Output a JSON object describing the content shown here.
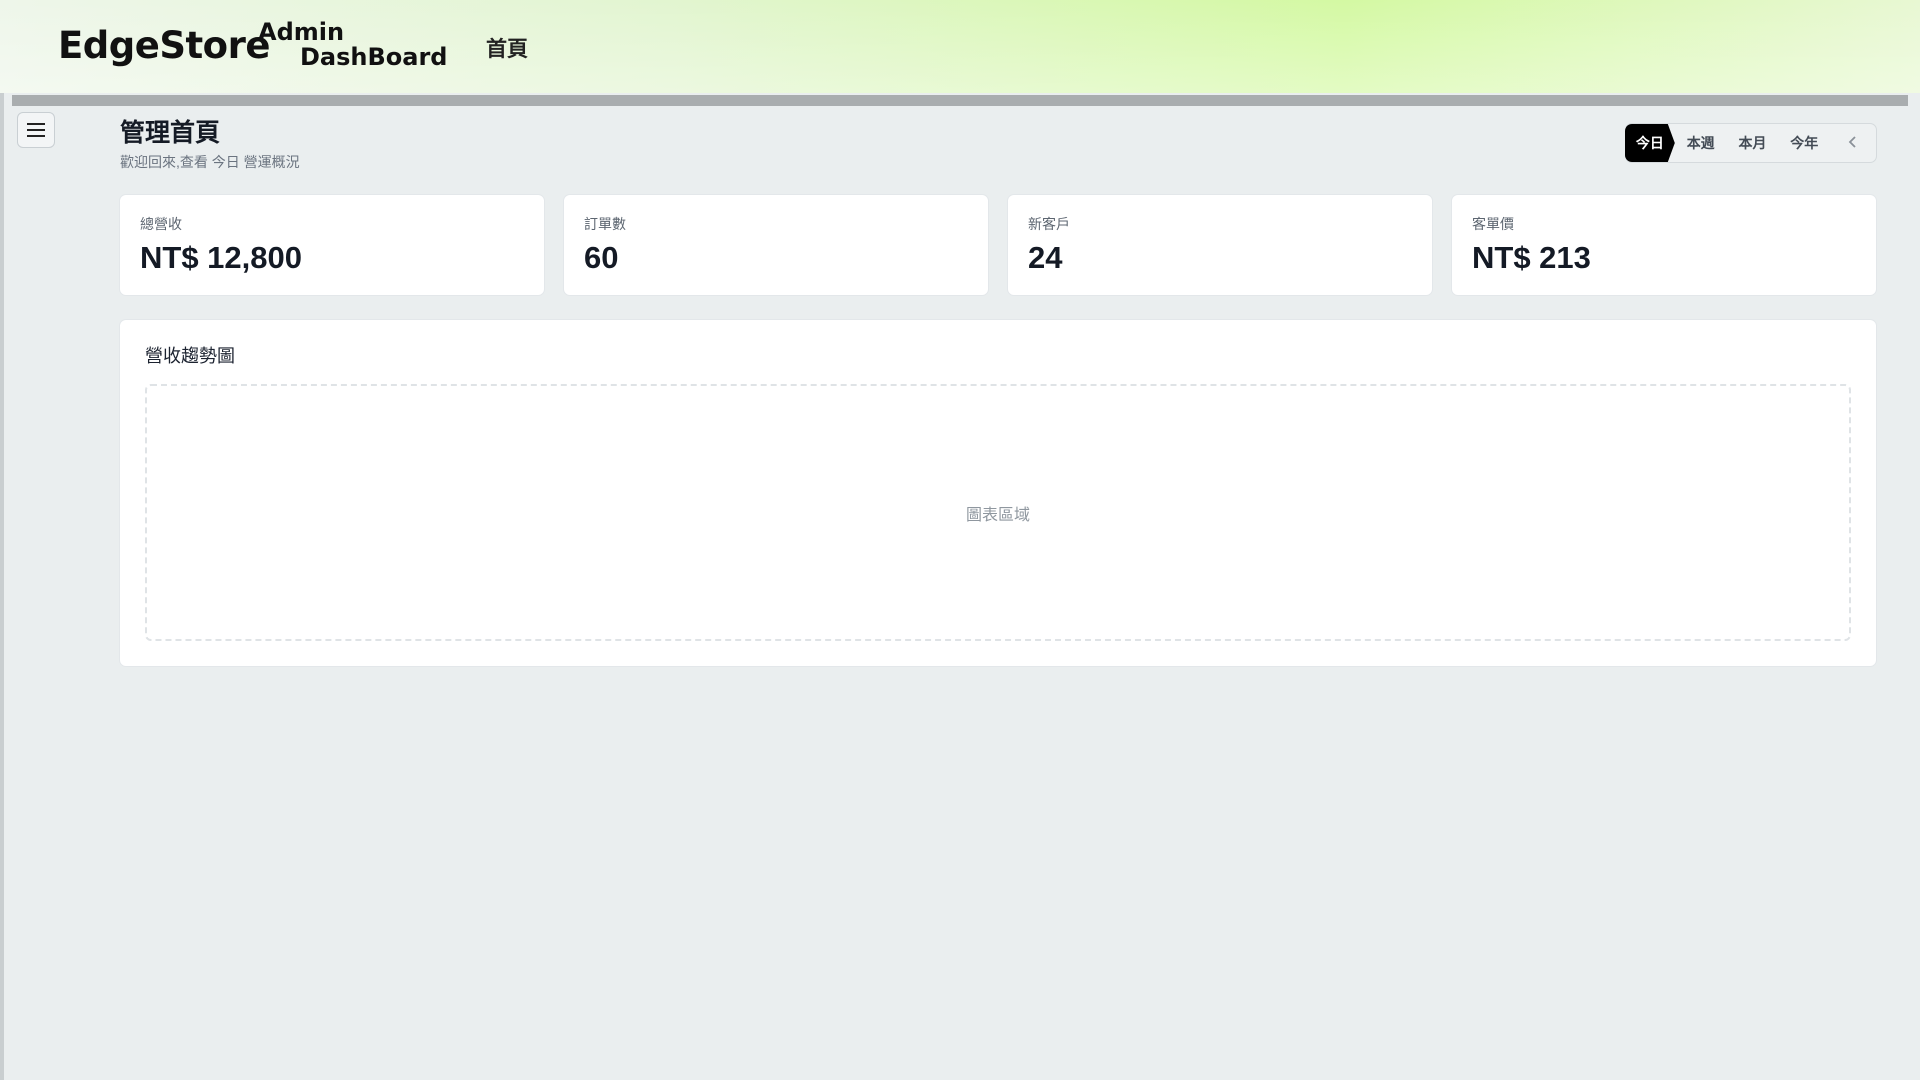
{
  "header": {
    "brand": "EdgeStore",
    "subtitle_line1": "Admin",
    "subtitle_line2": "DashBoard",
    "nav_home": "首頁",
    "gradient_colors": [
      "#eef6ea",
      "#d4f9a3"
    ]
  },
  "sidebar": {
    "menu_icon": "hamburger-menu-icon"
  },
  "page": {
    "title": "管理首頁",
    "subtitle": "歡迎回來,查看 今日 營運概況"
  },
  "range_switch": {
    "options": [
      "今日",
      "本週",
      "本月",
      "今年"
    ],
    "selected": "今日",
    "back_icon": "chevron-left-icon"
  },
  "stats": [
    {
      "label": "總營收",
      "value": "NT$ 12,800"
    },
    {
      "label": "訂單數",
      "value": "60"
    },
    {
      "label": "新客戶",
      "value": "24"
    },
    {
      "label": "客單價",
      "value": "NT$ 213"
    }
  ],
  "chart": {
    "title": "營收趨勢圖",
    "placeholder": "圖表區域"
  }
}
